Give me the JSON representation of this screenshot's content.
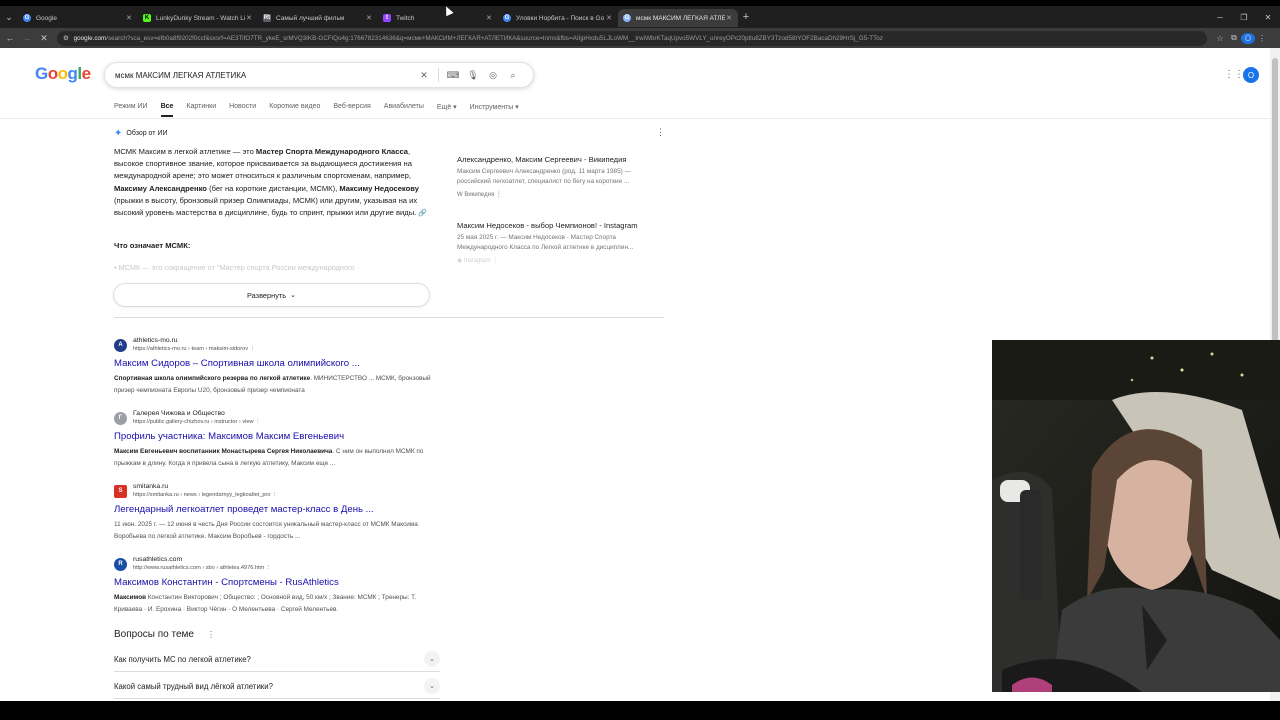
{
  "browser": {
    "tabs": [
      {
        "title": "Google",
        "favicon_color": "#4285f4",
        "favicon_glyph": "G"
      },
      {
        "title": "LunkyDunky Stream - Watch Li",
        "favicon_color": "#53fc18",
        "favicon_glyph": "K"
      },
      {
        "title": "Самый лучший фильм",
        "favicon_color": "#5f6368",
        "favicon_glyph": "Rt"
      },
      {
        "title": "Twitch",
        "favicon_color": "#9146ff",
        "favicon_glyph": "t"
      },
      {
        "title": "Уловки Норбита - Поиск в Go",
        "favicon_color": "#4285f4",
        "favicon_glyph": "G"
      },
      {
        "title": "мсмк МАКСИМ ЛЕГКАЯ АТЛЕТ",
        "favicon_color": "#8ab4f8",
        "favicon_glyph": "G"
      }
    ],
    "url_host": "google.com",
    "url_rest": "/search?sca_esv=efb0a8f9202f0ccf&sxsrf=AE3TifO7TR_ykeE_srMVQ3IKB-GCFiQo4g:1766782314636&q=мсмк+МАКСИМ+ЛЕГКАЯ+АТЛЕТИКА&source=lnms&fbs=AIIjpHxdu5LJLoWM__IrwiWbrKTaqUpvo5WVLY_unreyOPc20ptlu8ZBY3Tzod58tYOF2BacaDh29HrSj_G5-TToz"
  },
  "google": {
    "logo": "Google",
    "query": "мсмк МАКСИМ ЛЕГКАЯ АТЛЕТИКА",
    "filters": [
      "Режим ИИ",
      "Все",
      "Картинки",
      "Новости",
      "Короткие видео",
      "Веб-версия",
      "Авиабилеты",
      "Ещё ▾",
      "Инструменты ▾"
    ],
    "avatar_letter": "O"
  },
  "ai_overview": {
    "label": "Обзор от ИИ",
    "p1": "МСМК Максим в легкой атлетике — это ",
    "b1": "Мастер Спорта Международного Класса",
    "p2": ", высокое спортивное звание, которое присваивается за выдающиеся достижения на международной арене; это может относиться к различным спортсменам, например, ",
    "b2": "Максиму Александренко",
    "p3": " (бег на короткие дистанции, МСМК), ",
    "b3": "Максиму Недосекову",
    "p4": " (прыжки в высоту, бронзовый призер Олимпиады, МСМК) или другим, указывая на их высокий уровень мастерства в дисциплине, будь то спринт, прыжки или другие виды.",
    "question": "Что означает МСМК:",
    "fade_text": "МСМК — это сокращение от \"Мастер спорта России международного",
    "expand_label": "Развернуть",
    "sources": [
      {
        "title": "Александренко, Максим Сергеевич - Википедия",
        "snippet": "Максим Сергеевич Александренко (род. 11 марта 1985) — российский легкоатлет, специалист по бегу на короткие ...",
        "site": "Википедия"
      },
      {
        "title": "Максим Недосеков - выбор Чемпионов! - Instagram",
        "snippet": "25 мая 2025 г. — Максим Недосеков - Мастер Спорта Международного Класса по Легкой атлетике в дисциплин...",
        "site": "Instagram"
      }
    ]
  },
  "results": [
    {
      "site": "athletics-mo.ru",
      "url": "https://athletics-mo.ru › team › maksim-sidorov",
      "title": "Максим Сидоров – Спортивная школа олимпийского ...",
      "snippet_bold": "Спортивная школа олимпийского резерва по легкой атлетике",
      "snippet": ". МИНИСТЕРСТВО ... МСМК, бронзовый призер чемпионата Европы U20, бронзовый призер чемпионата",
      "fav_color": "#1f3c88",
      "fav_glyph": "A"
    },
    {
      "site": "Галерея Чижова и Общество",
      "url": "https://public.gallery-chizhov.ru › instructor › view",
      "title": "Профиль участника: Максимов Максим Евгеньевич",
      "snippet_bold": "Максим Евгеньевич воспитанник Монастырева Сергея Николаевича",
      "snippet": ". С ним он выполнил МСМК по прыжкам в длину. Когда я привела сына в легкую атлетику, Максим еще ...",
      "fav_color": "#9aa0a6",
      "fav_glyph": "Г"
    },
    {
      "site": "smitanka.ru",
      "url": "https://smitanka.ru › news › legendarnyy_legkoatlet_pro",
      "title": "Легендарный легкоатлет проведет мастер-класс в День ...",
      "snippet_bold": "",
      "snippet": "11 июн. 2025 г. — 12 июня в честь Дня России состоится уникальный мастер-класс от МСМК Максима Воробьева по легкой атлетике. Максим Воробьев - гордость ...",
      "fav_color": "#d93025",
      "fav_glyph": "S"
    },
    {
      "site": "rusathletics.com",
      "url": "http://www.rusathletics.com › sbo › athletes.4976.htm",
      "title": "Максимов Константин - Спортсмены - RusAthletics",
      "snippet_bold": "Максимов",
      "snippet": " Константин Викторович ; Общество: ; Основной вид, 50 км/х ; Звание: МСМК ; Тренеры: Т. Криваева · И. Ерохина · Виктор Чёгин · О Мелентьева · Сергей Мелентьев.",
      "fav_color": "#174ea6",
      "fav_glyph": "R"
    }
  ],
  "paa": {
    "title": "Вопросы по теме",
    "items": [
      "Как получить МС по легкой атлетике?",
      "Какой самый трудный вид лёгкой атлетики?"
    ]
  },
  "colors": {
    "link": "#1a0dab",
    "chrome": "#1f1f1f",
    "accent": "#1a73e8"
  }
}
